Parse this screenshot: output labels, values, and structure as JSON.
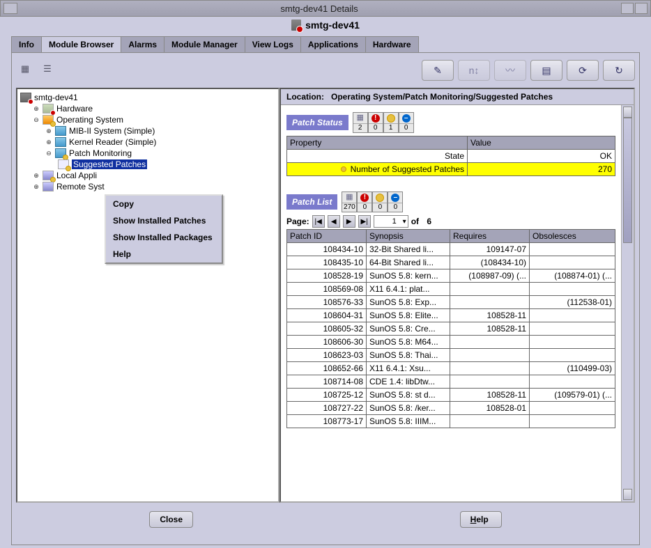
{
  "window": {
    "title": "smtg-dev41 Details",
    "host": "smtg-dev41"
  },
  "tabs": {
    "items": [
      "Info",
      "Module Browser",
      "Alarms",
      "Module Manager",
      "View Logs",
      "Applications",
      "Hardware"
    ],
    "active": 1
  },
  "tree": {
    "root": "smtg-dev41",
    "hardware": "Hardware",
    "os": "Operating System",
    "mib2": "MIB-II System (Simple)",
    "kernel": "Kernel Reader (Simple)",
    "patchmon": "Patch Monitoring",
    "suggested": "Suggested Patches",
    "localapps": "Local Appli",
    "remote": "Remote Syst"
  },
  "contextMenu": {
    "items": [
      "Copy",
      "Show Installed Patches",
      "Show Installed Packages",
      "Help"
    ]
  },
  "location": {
    "label": "Location:",
    "path": "Operating System/Patch Monitoring/Suggested Patches"
  },
  "patchStatus": {
    "title": "Patch Status",
    "badges": {
      "grid": "2",
      "red": "0",
      "yellow": "1",
      "blue": "0"
    },
    "headers": {
      "prop": "Property",
      "val": "Value"
    },
    "rows": [
      {
        "prop": "State",
        "val": "OK",
        "hl": false
      },
      {
        "prop": "Number of Suggested Patches",
        "val": "270",
        "hl": true,
        "dot": true
      }
    ]
  },
  "patchList": {
    "title": "Patch List",
    "badges": {
      "grid": "270",
      "red": "0",
      "yellow": "0",
      "blue": "0"
    },
    "pager": {
      "label": "Page:",
      "current": "1",
      "of": "of",
      "total": "6"
    },
    "headers": [
      "Patch ID",
      "Synopsis",
      "Requires",
      "Obsolesces"
    ],
    "rows": [
      {
        "id": "108434-10",
        "syn": "32-Bit Shared li...",
        "req": "109147-07",
        "obs": ""
      },
      {
        "id": "108435-10",
        "syn": "64-Bit Shared li...",
        "req": "(108434-10)",
        "obs": ""
      },
      {
        "id": "108528-19",
        "syn": "SunOS 5.8: kern...",
        "req": "(108987-09) (...",
        "obs": "(108874-01) (..."
      },
      {
        "id": "108569-08",
        "syn": "X11 6.4.1: plat...",
        "req": "",
        "obs": ""
      },
      {
        "id": "108576-33",
        "syn": "SunOS 5.8: Exp...",
        "req": "",
        "obs": "(112538-01)"
      },
      {
        "id": "108604-31",
        "syn": "SunOS 5.8: Elite...",
        "req": "108528-11",
        "obs": ""
      },
      {
        "id": "108605-32",
        "syn": "SunOS 5.8: Cre...",
        "req": "108528-11",
        "obs": ""
      },
      {
        "id": "108606-30",
        "syn": "SunOS 5.8: M64...",
        "req": "",
        "obs": ""
      },
      {
        "id": "108623-03",
        "syn": "SunOS 5.8: Thai...",
        "req": "",
        "obs": ""
      },
      {
        "id": "108652-66",
        "syn": "X11 6.4.1: Xsu...",
        "req": "",
        "obs": "(110499-03)"
      },
      {
        "id": "108714-08",
        "syn": "CDE 1.4: libDtw...",
        "req": "",
        "obs": ""
      },
      {
        "id": "108725-12",
        "syn": "SunOS 5.8: st d...",
        "req": "108528-11",
        "obs": "(109579-01) (..."
      },
      {
        "id": "108727-22",
        "syn": "SunOS 5.8: /ker...",
        "req": "108528-01",
        "obs": ""
      },
      {
        "id": "108773-17",
        "syn": "SunOS 5.8: IIIM...",
        "req": "",
        "obs": ""
      }
    ]
  },
  "buttons": {
    "close": "Close",
    "help": "Help"
  }
}
